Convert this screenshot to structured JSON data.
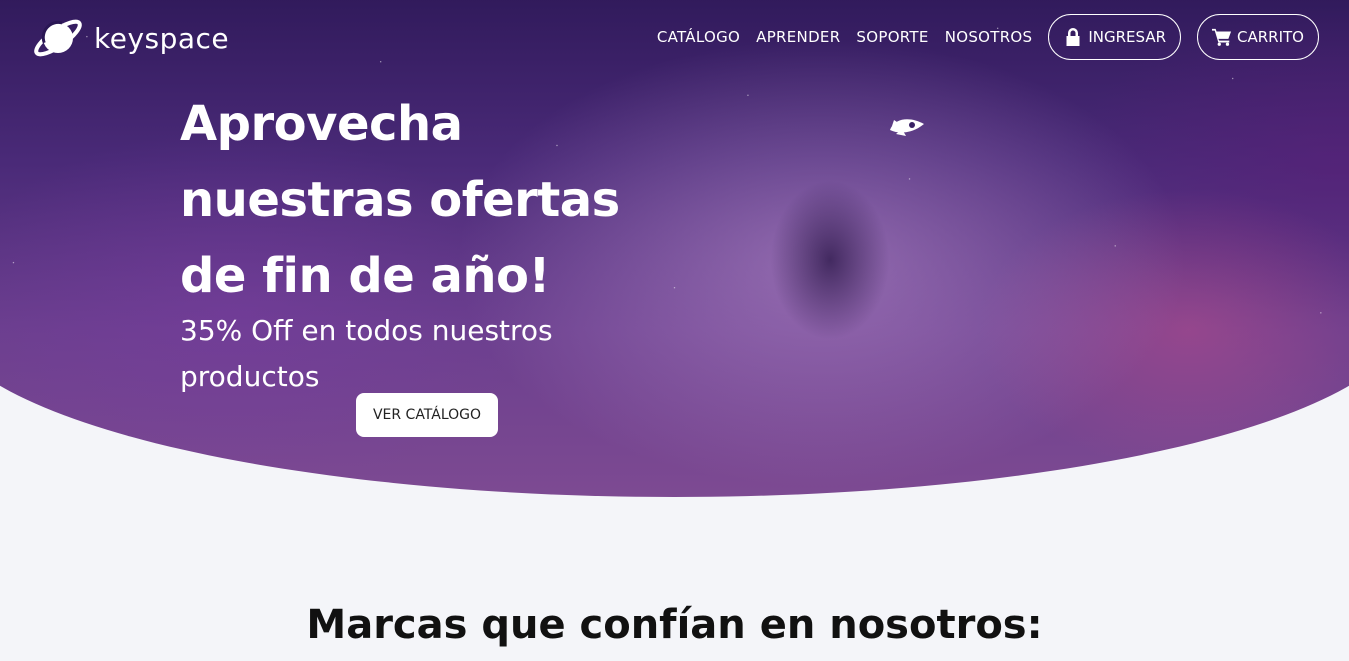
{
  "header": {
    "brand": "keyspace",
    "nav": [
      "CATÁLOGO",
      "APRENDER",
      "SOPORTE",
      "NOSOTROS"
    ],
    "login_label": "INGRESAR",
    "cart_label": "CARRITO"
  },
  "hero": {
    "title": "Aprovecha nuestras ofertas de fin de año!",
    "subtitle": "35% Off en todos nuestros productos",
    "cta_label": "VER CATÁLOGO"
  },
  "brands": {
    "title": "Marcas que confían en nosotros:"
  },
  "icons": {
    "logo": "planet-icon",
    "login": "lock-icon",
    "cart": "cart-icon",
    "decor": "rocket-icon"
  },
  "colors": {
    "page_bg": "#f4f5f9",
    "hero_top": "#1d1240",
    "hero_bottom": "#7d4a92",
    "text_light": "#ffffff",
    "text_dark": "#111111"
  }
}
